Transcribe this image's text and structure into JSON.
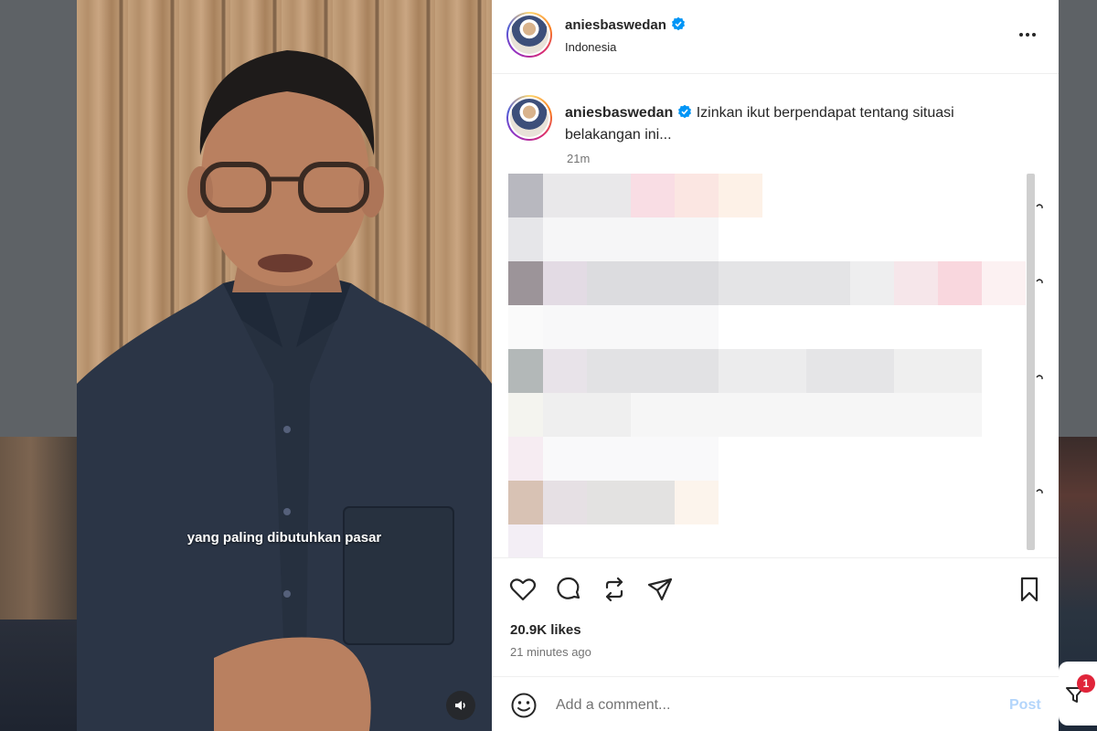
{
  "post": {
    "username": "aniesbaswedan",
    "location": "Indonesia",
    "caption_text": "Izinkan ikut berpendapat tentang situasi belakangan ini...",
    "caption_time": "21m",
    "likes": "20.9K likes",
    "posted_ago": "21 minutes ago",
    "verified": true
  },
  "video": {
    "subtitle": "yang paling dibutuhkan pasar"
  },
  "comment_box": {
    "placeholder": "Add a comment...",
    "post_label": "Post"
  },
  "notifications": {
    "badge_count": "1"
  },
  "icons": {
    "like": "heart-icon",
    "comment": "comment-bubble-icon",
    "repost": "repost-icon",
    "share": "paper-plane-icon",
    "save": "bookmark-icon",
    "emoji": "smiley-icon",
    "audio": "speaker-icon",
    "more": "more-dots-icon",
    "verified": "verified-badge-icon",
    "filter": "filter-icon"
  },
  "colors": {
    "verified_blue": "#0095f6",
    "post_button_disabled": "#b3d5fb",
    "badge_red": "#e0243a"
  }
}
